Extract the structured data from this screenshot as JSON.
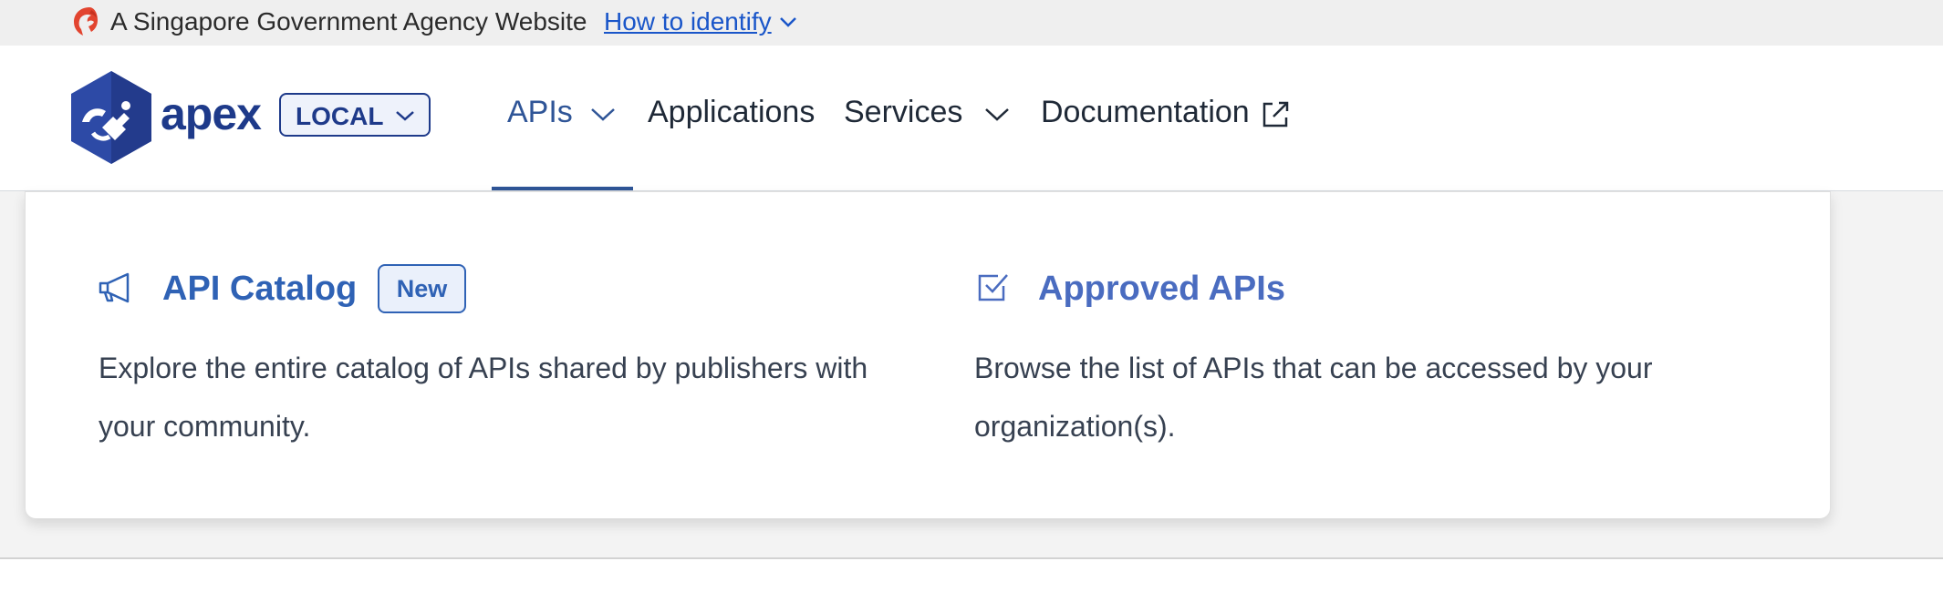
{
  "masthead": {
    "text": "A Singapore Government Agency Website",
    "link": "How to identify",
    "lion_icon": "singapore-lion-icon",
    "chevron_icon": "chevron-down-icon"
  },
  "header": {
    "logo_text": "apex",
    "environment": "LOCAL",
    "nav": {
      "apis": "APIs",
      "applications": "Applications",
      "services": "Services",
      "documentation": "Documentation"
    },
    "active_tab": "APIs"
  },
  "dropdown": {
    "items": [
      {
        "title": "API Catalog",
        "badge": "New",
        "icon": "megaphone-icon",
        "description": "Explore the entire catalog of APIs shared by publishers with your community."
      },
      {
        "title": "Approved APIs",
        "icon": "checkbox-icon",
        "description": "Browse the list of APIs that can be accessed by your organization(s)."
      }
    ]
  },
  "colors": {
    "brand": "#1e3a8a",
    "accent": "#2f62b5",
    "link": "#1a56c9",
    "lion": "#e2442f"
  }
}
